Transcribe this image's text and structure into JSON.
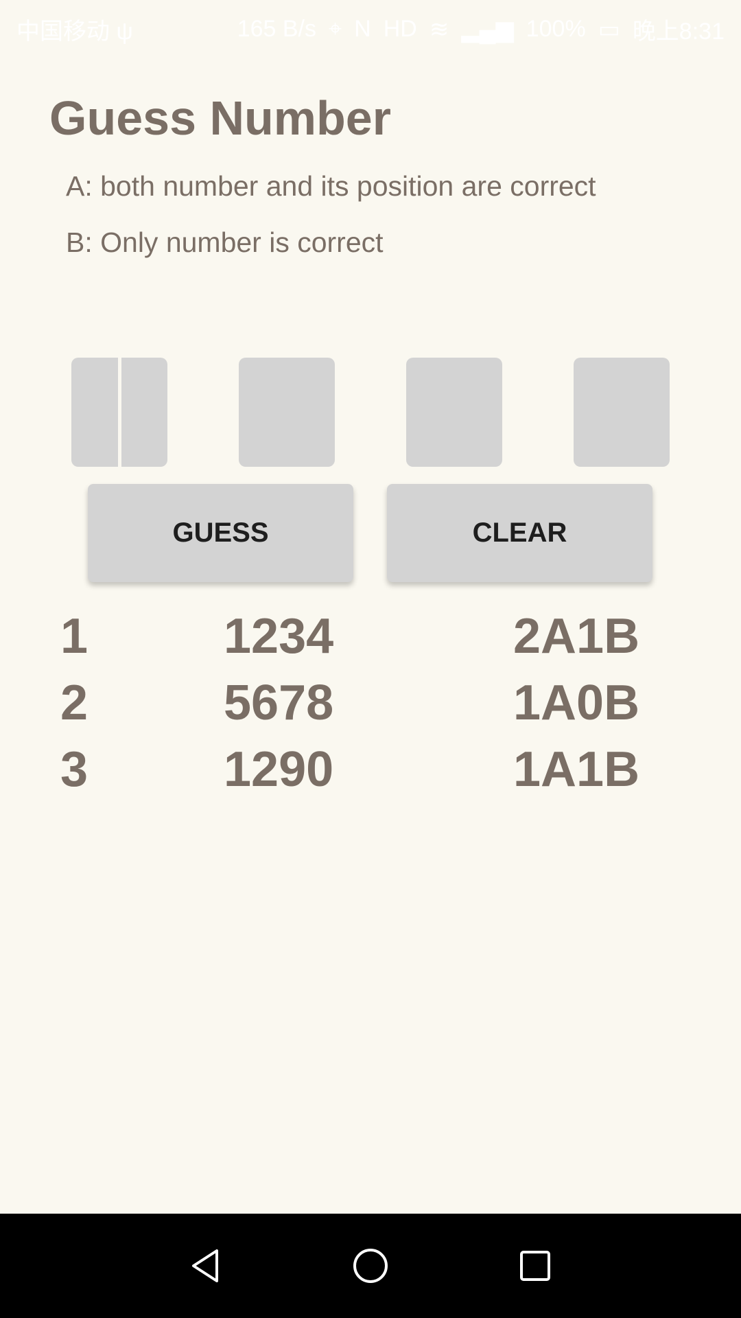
{
  "status_bar": {
    "carrier": "中国移动 ψ",
    "speed": "165 B/s",
    "battery": "100%",
    "time": "晚上8:31",
    "icons": [
      "location-icon",
      "nfc-icon",
      "hd-icon",
      "wifi-icon",
      "signal-icon",
      "battery-icon"
    ]
  },
  "title": "Guess Number",
  "rules": {
    "a": "A: both number and its position are correct",
    "b": "B: Only number is correct"
  },
  "digit_inputs": [
    "",
    "",
    "",
    ""
  ],
  "buttons": {
    "guess": "GUESS",
    "clear": "CLEAR"
  },
  "history": [
    {
      "index": "1",
      "number": "1234",
      "result": "2A1B"
    },
    {
      "index": "2",
      "number": "5678",
      "result": "1A0B"
    },
    {
      "index": "3",
      "number": "1290",
      "result": "1A1B"
    }
  ],
  "nav": {
    "icons": [
      "back-icon",
      "home-icon",
      "recents-icon"
    ]
  },
  "colors": {
    "background": "#FAF8F0",
    "text": "#7A6E65",
    "box": "#D3D3D3",
    "button_text": "#1E1E1E",
    "nav_bar": "#000000"
  }
}
